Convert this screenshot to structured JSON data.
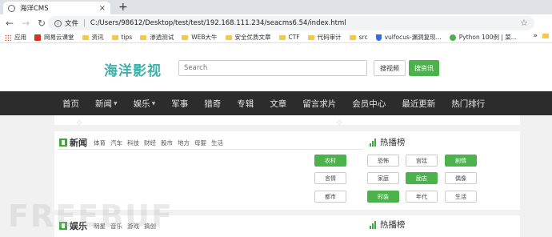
{
  "browser": {
    "tab_title": "海洋CMS",
    "tab_close": "×",
    "new_tab": "+",
    "address_label": "文件",
    "address_url": "C:/Users/98612/Desktop/test/test/192.168.111.234/seacms6.54/index.html",
    "bookmarks": [
      "应用",
      "网易云课堂",
      "资讯",
      "tips",
      "渗透测试",
      "WEB大牛",
      "安全优质文章",
      "CTF",
      "代码审计",
      "src",
      "vulfocus-漏洞复现...",
      "Python 100例 | 菜..."
    ],
    "bookmarks_more": "»"
  },
  "header": {
    "logo": "海洋影视",
    "search_placeholder": "Search",
    "btn_video": "搜视频",
    "btn_news": "搜资讯"
  },
  "nav": {
    "items": [
      "首页",
      "新闻",
      "娱乐",
      "军事",
      "猎奇",
      "专辑",
      "文章",
      "留言求片",
      "会员中心",
      "最近更新",
      "热门排行"
    ]
  },
  "news": {
    "title": "新闻",
    "subcats": [
      "体育",
      "汽车",
      "科技",
      "财经",
      "股市",
      "地方",
      "母婴",
      "生活"
    ],
    "hot_title": "热播榜",
    "tags": [
      {
        "label": "农村",
        "active": true
      },
      {
        "label": "恐怖",
        "active": false
      },
      {
        "label": "宫廷",
        "active": false
      },
      {
        "label": "剧情",
        "active": true
      },
      {
        "label": "言情",
        "active": false
      },
      {
        "label": "家庭",
        "active": false
      },
      {
        "label": "励志",
        "active": true
      },
      {
        "label": "偶像",
        "active": false
      },
      {
        "label": "都市",
        "active": false
      },
      {
        "label": "时装",
        "active": true
      },
      {
        "label": "年代",
        "active": false
      },
      {
        "label": "生活",
        "active": false
      }
    ]
  },
  "entertainment": {
    "title": "娱乐",
    "subcats": [
      "明星",
      "音乐",
      "游戏",
      "搞创"
    ],
    "hot_title": "热播榜"
  },
  "watermark": "FREEBUF",
  "colors": {
    "accent_green": "#4cb34c",
    "logo_teal": "#3fb0a8",
    "nav_bg": "#2c2c2c"
  }
}
